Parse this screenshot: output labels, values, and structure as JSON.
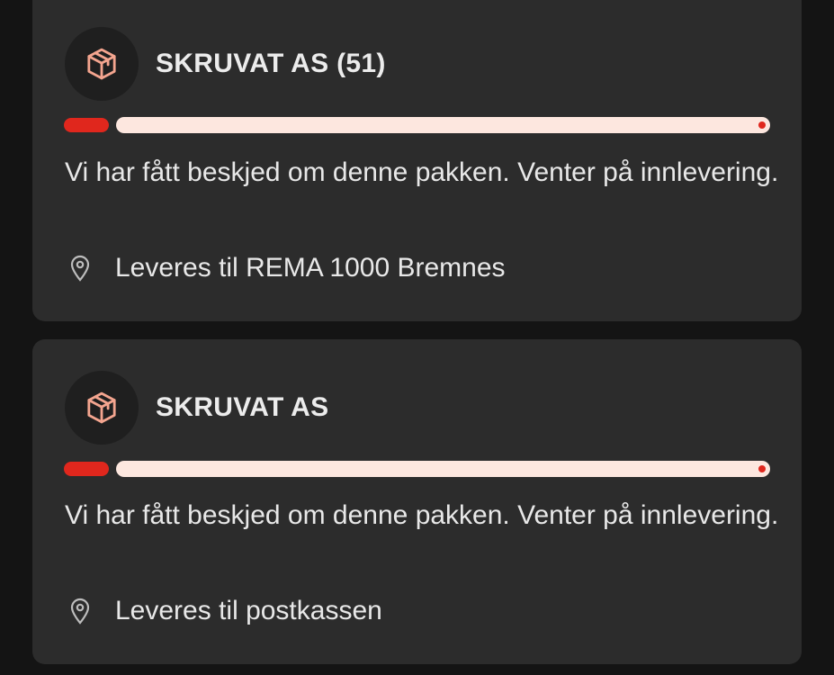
{
  "colors": {
    "background": "#141414",
    "card": "#2c2c2c",
    "accent_red": "#e0271d",
    "progress_track": "#fde7df",
    "icon_stroke": "#f4a58f"
  },
  "shipments": [
    {
      "sender": "SKRUVAT AS (51)",
      "icon": "package-icon",
      "progress": 0.07,
      "status": "Vi har fått beskjed om denne pakken. Venter på innlevering.",
      "location_icon": "location-pin-icon",
      "delivery": "Leveres til REMA 1000 Bremnes"
    },
    {
      "sender": "SKRUVAT AS",
      "icon": "package-icon",
      "progress": 0.07,
      "status": "Vi har fått beskjed om denne pakken. Venter på innlevering.",
      "location_icon": "location-pin-icon",
      "delivery": "Leveres til postkassen"
    }
  ]
}
